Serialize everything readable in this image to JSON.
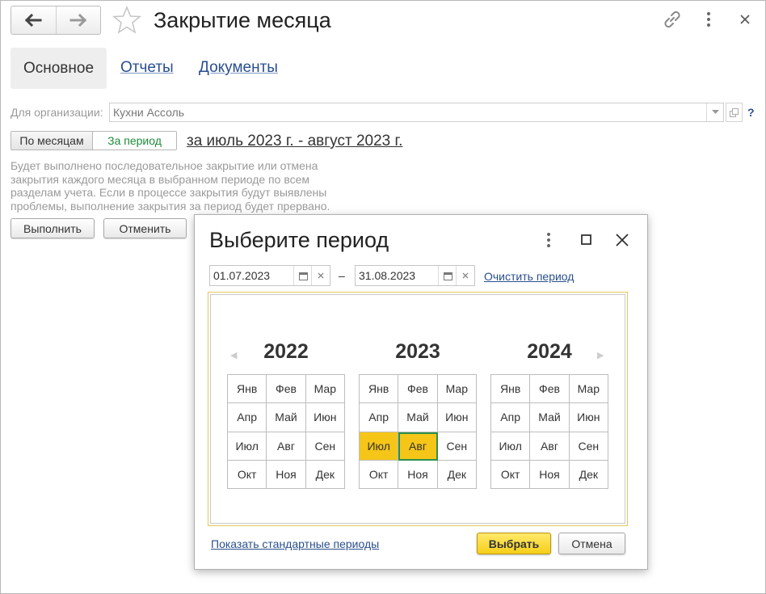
{
  "window": {
    "title": "Закрытие месяца"
  },
  "tabs": [
    {
      "label": "Основное",
      "active": true
    },
    {
      "label": "Отчеты",
      "active": false
    },
    {
      "label": "Документы",
      "active": false
    }
  ],
  "organization": {
    "label": "Для организации:",
    "value": "Кухни Ассоль",
    "help": "?"
  },
  "mode_toggle": {
    "by_month": "По месяцам",
    "by_period": "За период",
    "selected": "За период"
  },
  "period_link": "за июль 2023 г. - август 2023 г.",
  "description": "Будет выполнено последовательное закрытие или отмена закрытия каждого месяца в выбранном периоде по всем разделам учета. Если в процессе закрытия будут выявлены проблемы, выполнение закрытия за период будет прервано.",
  "actions": {
    "run": "Выполнить",
    "cancel": "Отменить"
  },
  "dialog": {
    "title": "Выберите период",
    "date_from": "01.07.2023",
    "date_to": "31.08.2023",
    "separator": "–",
    "clear_link": "Очистить период",
    "years": [
      {
        "year": "2022",
        "months": [
          "Янв",
          "Фев",
          "Мар",
          "Апр",
          "Май",
          "Июн",
          "Июл",
          "Авг",
          "Сен",
          "Окт",
          "Ноя",
          "Дек"
        ]
      },
      {
        "year": "2023",
        "months": [
          "Янв",
          "Фев",
          "Мар",
          "Апр",
          "Май",
          "Июн",
          "Июл",
          "Авг",
          "Сен",
          "Окт",
          "Ноя",
          "Дек"
        ]
      },
      {
        "year": "2024",
        "months": [
          "Янв",
          "Фев",
          "Мар",
          "Апр",
          "Май",
          "Июн",
          "Июл",
          "Авг",
          "Сен",
          "Окт",
          "Ноя",
          "Дек"
        ]
      }
    ],
    "selected_months": [
      "2023-07",
      "2023-08"
    ],
    "focused_month": "2023-08",
    "std_periods_link": "Показать стандартные периоды",
    "select_button": "Выбрать",
    "cancel_button": "Отмена"
  },
  "colors": {
    "accent_yellow": "#f5c518",
    "link_blue": "#2a4f8f",
    "toggle_green": "#1e8a3a",
    "focus_green": "#2b8f4e"
  },
  "icons": {
    "back": "arrow-left-icon",
    "forward": "arrow-right-icon",
    "favorite": "star-icon",
    "link": "link-icon",
    "more": "more-vertical-icon",
    "close": "close-icon",
    "maximize": "maximize-icon",
    "calendar": "calendar-icon",
    "clear": "clear-icon"
  }
}
